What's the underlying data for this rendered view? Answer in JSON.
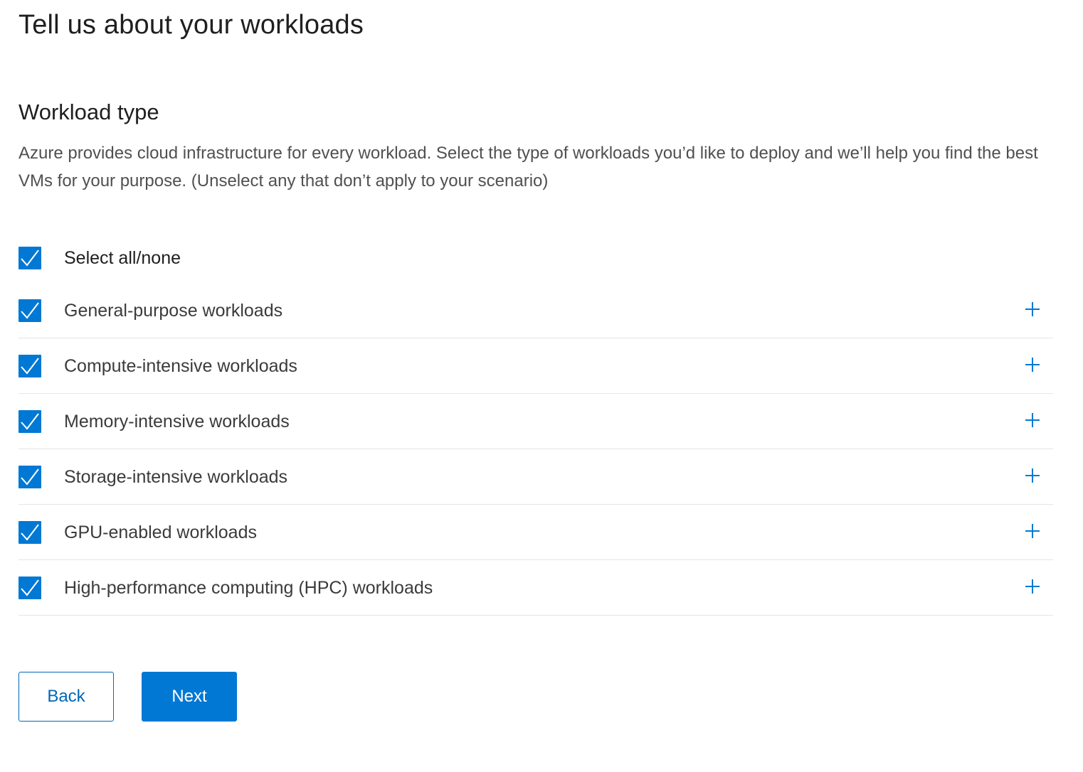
{
  "page": {
    "title": "Tell us about your workloads"
  },
  "section": {
    "title": "Workload type",
    "description": "Azure provides cloud infrastructure for every workload. Select the type of workloads you’d like to deploy and we’ll help you find the best VMs for your purpose. (Unselect any that don’t apply to your scenario)"
  },
  "select_all": {
    "label": "Select all/none",
    "checked": true
  },
  "workloads": [
    {
      "label": "General-purpose workloads",
      "checked": true
    },
    {
      "label": "Compute-intensive workloads",
      "checked": true
    },
    {
      "label": "Memory-intensive workloads",
      "checked": true
    },
    {
      "label": "Storage-intensive workloads",
      "checked": true
    },
    {
      "label": "GPU-enabled workloads",
      "checked": true
    },
    {
      "label": "High-performance computing (HPC) workloads",
      "checked": true
    }
  ],
  "icons": {
    "checkbox": "checkmark-icon",
    "expand": "plus-icon"
  },
  "buttons": {
    "back_label": "Back",
    "next_label": "Next"
  },
  "colors": {
    "accent": "#0078d4",
    "link": "#0067b8",
    "divider": "#e5e5e5",
    "body_text": "#505050"
  }
}
